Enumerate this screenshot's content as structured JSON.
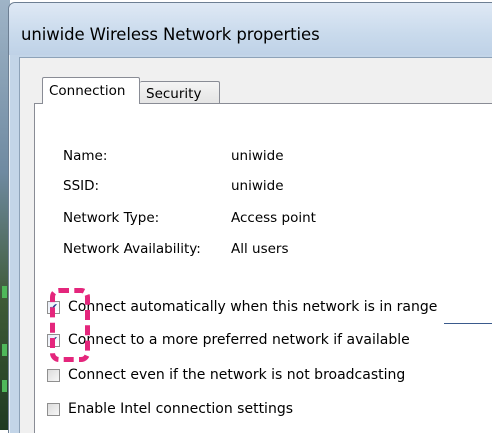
{
  "window": {
    "title": "uniwide Wireless Network properties"
  },
  "tabs": [
    {
      "label": "Connection",
      "active": true
    },
    {
      "label": "Security",
      "active": false
    }
  ],
  "properties": [
    {
      "label": "Name:",
      "value": "uniwide"
    },
    {
      "label": "SSID:",
      "value": "uniwide"
    },
    {
      "label": "Network Type:",
      "value": "Access point"
    },
    {
      "label": "Network Availability:",
      "value": "All users"
    }
  ],
  "options": [
    {
      "label": "Connect automatically when this network is in range",
      "checked": true
    },
    {
      "label": "Connect to a more preferred network if available",
      "checked": true
    },
    {
      "label": "Connect even if the network is not broadcasting",
      "checked": false
    },
    {
      "label": "Enable Intel connection settings",
      "checked": false
    }
  ],
  "colors": {
    "annotation": "#e4267c",
    "title_bar": "#c9daec",
    "window_frame": "#c3d5e8"
  }
}
